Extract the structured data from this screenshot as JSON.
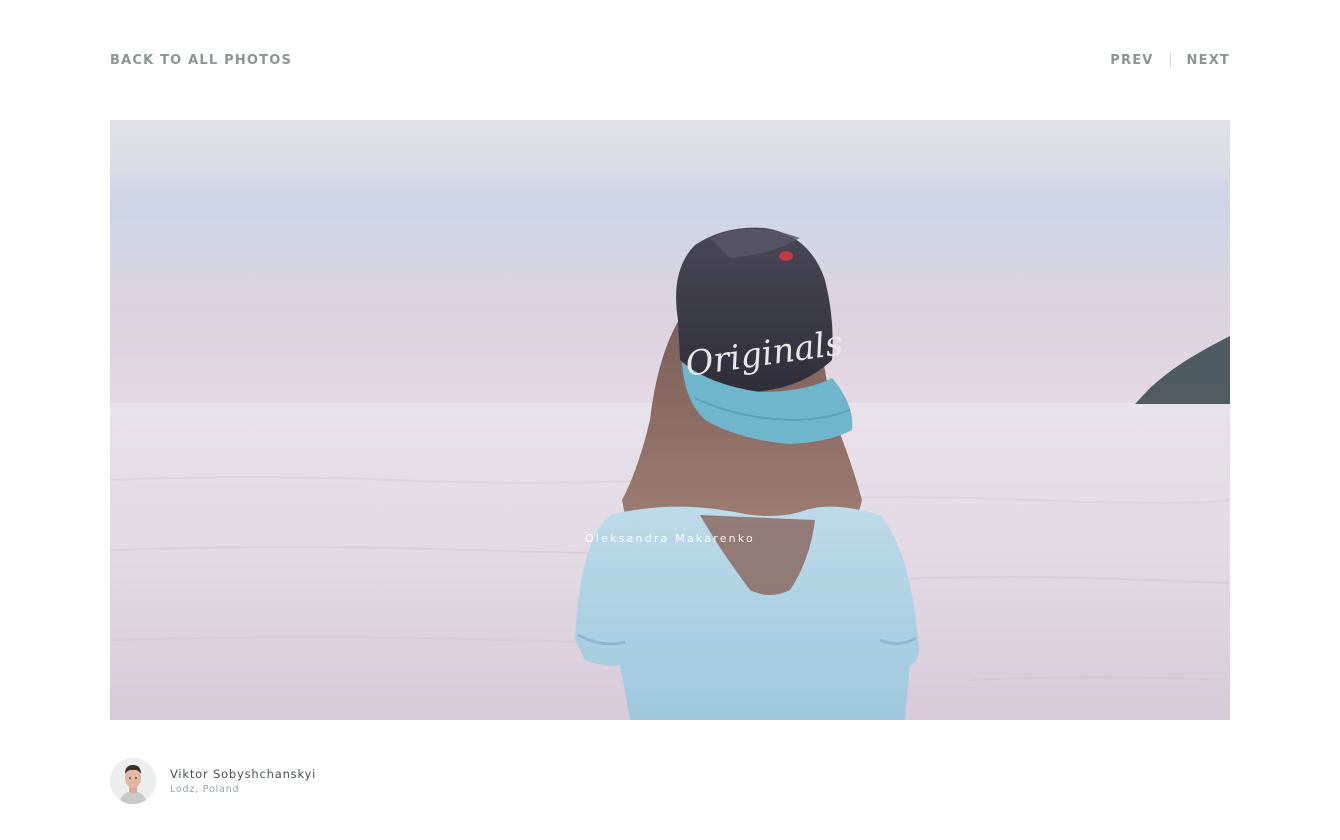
{
  "nav": {
    "back_label": "BACK TO ALL PHOTOS",
    "prev_label": "PREV",
    "next_label": "NEXT"
  },
  "photo": {
    "caption": "Oleksandra Makarenko",
    "cap_text": "Originals"
  },
  "author": {
    "name": "Viktor Sobyshchanskyi",
    "location": "Lodz, Poland"
  },
  "colors": {
    "nav_text": "#8c9494",
    "sky": "#d8dae6",
    "sea": "#e6dfe8",
    "cap_brim": "#6fb6cc",
    "shirt": "#a9cfe0"
  }
}
